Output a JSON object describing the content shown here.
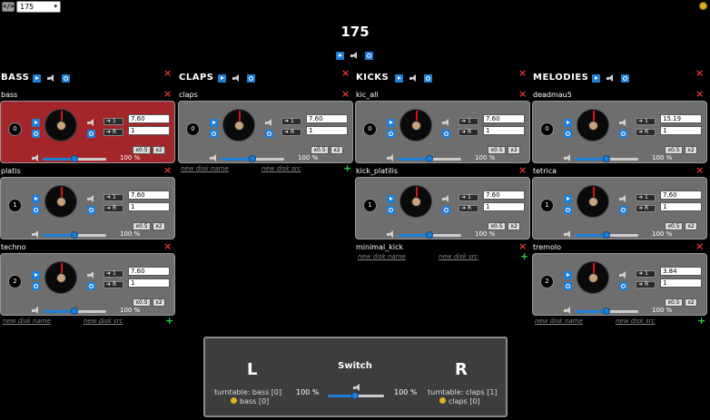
{
  "toolbar": {
    "code_label": "</>",
    "bpm_select": "175"
  },
  "bpm": "175",
  "columns": [
    {
      "title": "BASS",
      "tracks": [
        {
          "name": "bass",
          "num": "0",
          "f1": "7.60",
          "f2": "1",
          "vol": "100 %"
        },
        {
          "name": "platis",
          "num": "1",
          "f1": "7.60",
          "f2": "1",
          "vol": "100 %"
        },
        {
          "name": "techno",
          "num": "2",
          "f1": "7.60",
          "f2": "1",
          "vol": "100 %"
        }
      ],
      "new_name": "new disk name",
      "new_src": "new disk src"
    },
    {
      "title": "CLAPS",
      "tracks": [
        {
          "name": "claps",
          "num": "0",
          "f1": "7.60",
          "f2": "1",
          "vol": "100 %"
        }
      ],
      "new_name": "new disk name",
      "new_src": "new disk src"
    },
    {
      "title": "KICKS",
      "tracks": [
        {
          "name": "kic_all",
          "num": "0",
          "f1": "7.60",
          "f2": "1",
          "vol": "100 %"
        },
        {
          "name": "kick_platilis",
          "num": "1",
          "f1": "7.60",
          "f2": "1",
          "vol": "100 %"
        },
        {
          "name": "minimal_kick",
          "num": "",
          "f1": "",
          "f2": "",
          "vol": ""
        }
      ],
      "new_name": "new disk name",
      "new_src": "new disk src"
    },
    {
      "title": "MELODIES",
      "tracks": [
        {
          "name": "deadmau5",
          "num": "0",
          "f1": "15.19",
          "f2": "1",
          "vol": "100 %"
        },
        {
          "name": "tetrica",
          "num": "1",
          "f1": "7.60",
          "f2": "1",
          "vol": "100 %"
        },
        {
          "name": "tremolo",
          "num": "2",
          "f1": "3.84",
          "f2": "1",
          "vol": "100 %"
        }
      ],
      "new_name": "new disk name",
      "new_src": "new disk src"
    }
  ],
  "buttons": {
    "btn1": "1",
    "btnR": "R",
    "half": "x0.5",
    "double": "x2"
  },
  "switch": {
    "title": "Switch",
    "left": "L",
    "right": "R",
    "left_pct": "100 %",
    "right_pct": "100 %",
    "left_turntable": "turntable: bass [0]",
    "left_bass": "bass [0]",
    "right_turntable": "turntable: claps [1]",
    "right_claps": "claps [0]"
  }
}
